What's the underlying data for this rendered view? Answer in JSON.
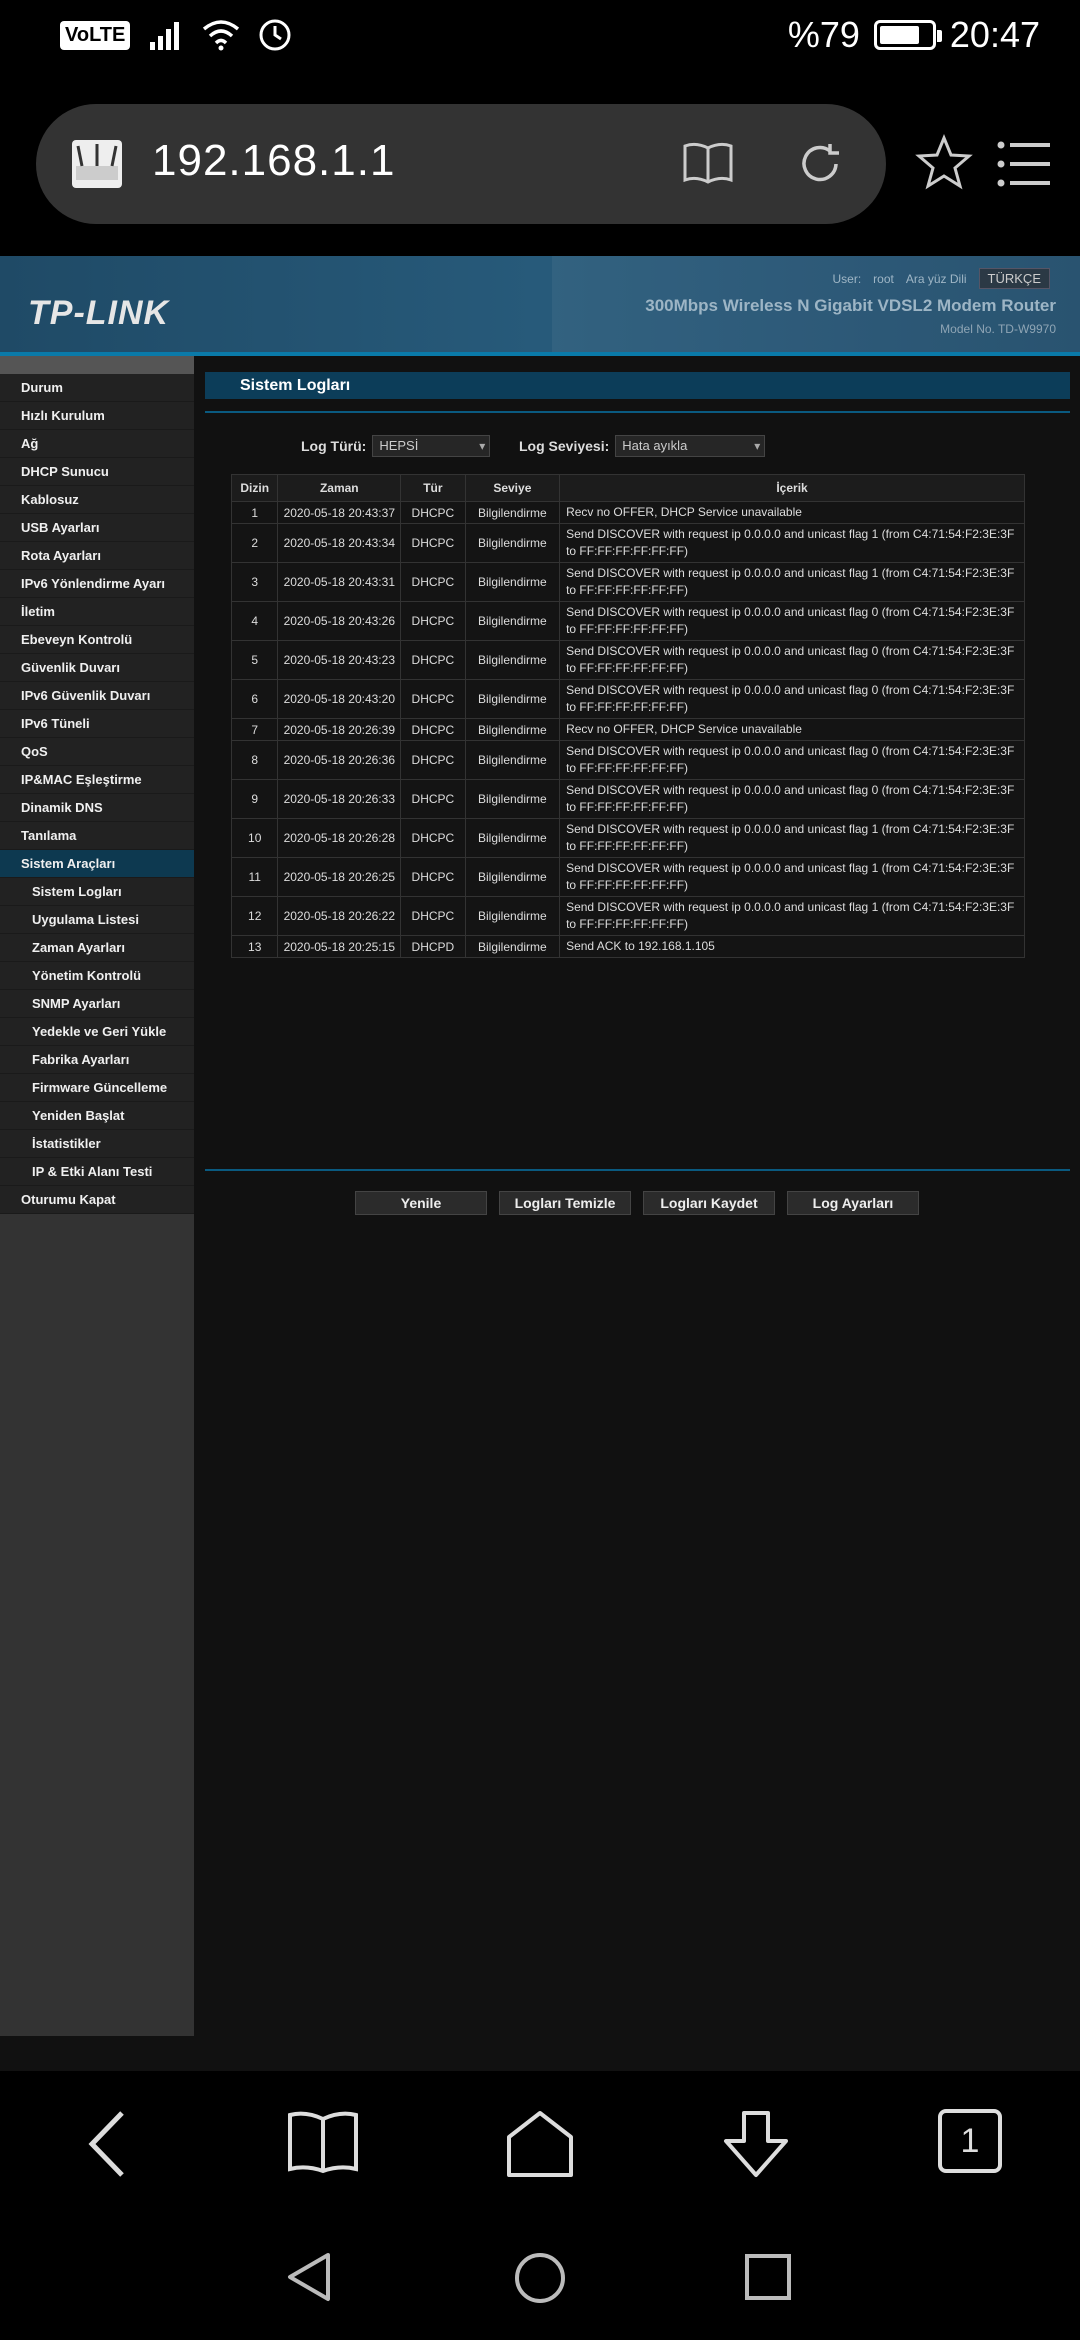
{
  "status_bar": {
    "battery": "%79",
    "time": "20:47",
    "network": "VoLTE"
  },
  "browser": {
    "url": "192.168.1.1",
    "tab_count": "1"
  },
  "router": {
    "brand": "TP-LINK",
    "user_label": "User:",
    "user": "root",
    "lang_label": "Ara yüz Dili",
    "lang": "TÜRKÇE",
    "model_title": "300Mbps Wireless N Gigabit VDSL2 Modem Router",
    "model_no": "Model No. TD-W9970"
  },
  "sidebar": [
    {
      "label": "Durum",
      "sub": false
    },
    {
      "label": "Hızlı Kurulum",
      "sub": false
    },
    {
      "label": "Ağ",
      "sub": false
    },
    {
      "label": "DHCP Sunucu",
      "sub": false
    },
    {
      "label": "Kablosuz",
      "sub": false
    },
    {
      "label": "USB Ayarları",
      "sub": false
    },
    {
      "label": "Rota Ayarları",
      "sub": false
    },
    {
      "label": "IPv6 Yönlendirme Ayarı",
      "sub": false
    },
    {
      "label": "İletim",
      "sub": false
    },
    {
      "label": "Ebeveyn Kontrolü",
      "sub": false
    },
    {
      "label": "Güvenlik Duvarı",
      "sub": false
    },
    {
      "label": "IPv6 Güvenlik Duvarı",
      "sub": false
    },
    {
      "label": "IPv6 Tüneli",
      "sub": false
    },
    {
      "label": "QoS",
      "sub": false
    },
    {
      "label": "IP&MAC Eşleştirme",
      "sub": false
    },
    {
      "label": "Dinamik DNS",
      "sub": false
    },
    {
      "label": "Tanılama",
      "sub": false
    },
    {
      "label": "Sistem Araçları",
      "sub": false,
      "active": true
    },
    {
      "label": "Sistem Logları",
      "sub": true
    },
    {
      "label": "Uygulama Listesi",
      "sub": true
    },
    {
      "label": "Zaman Ayarları",
      "sub": true
    },
    {
      "label": "Yönetim Kontrolü",
      "sub": true
    },
    {
      "label": "SNMP Ayarları",
      "sub": true
    },
    {
      "label": "Yedekle ve Geri Yükle",
      "sub": true
    },
    {
      "label": "Fabrika Ayarları",
      "sub": true
    },
    {
      "label": "Firmware Güncelleme",
      "sub": true
    },
    {
      "label": "Yeniden Başlat",
      "sub": true
    },
    {
      "label": "İstatistikler",
      "sub": true
    },
    {
      "label": "IP & Etki Alanı Testi",
      "sub": true
    },
    {
      "label": "Oturumu Kapat",
      "sub": false
    }
  ],
  "page": {
    "title": "Sistem Logları",
    "log_type_label": "Log Türü:",
    "log_type": "HEPSİ",
    "log_level_label": "Log Seviyesi:",
    "log_level": "Hata ayıkla",
    "columns": [
      "Dizin",
      "Zaman",
      "Tür",
      "Seviye",
      "İçerik"
    ],
    "rows": [
      [
        "1",
        "2020-05-18 20:43:37",
        "DHCPC",
        "Bilgilendirme",
        "Recv no OFFER, DHCP Service unavailable"
      ],
      [
        "2",
        "2020-05-18 20:43:34",
        "DHCPC",
        "Bilgilendirme",
        "Send DISCOVER with request ip 0.0.0.0 and unicast flag 1 (from C4:71:54:F2:3E:3F to FF:FF:FF:FF:FF:FF)"
      ],
      [
        "3",
        "2020-05-18 20:43:31",
        "DHCPC",
        "Bilgilendirme",
        "Send DISCOVER with request ip 0.0.0.0 and unicast flag 1 (from C4:71:54:F2:3E:3F to FF:FF:FF:FF:FF:FF)"
      ],
      [
        "4",
        "2020-05-18 20:43:26",
        "DHCPC",
        "Bilgilendirme",
        "Send DISCOVER with request ip 0.0.0.0 and unicast flag 0 (from C4:71:54:F2:3E:3F to FF:FF:FF:FF:FF:FF)"
      ],
      [
        "5",
        "2020-05-18 20:43:23",
        "DHCPC",
        "Bilgilendirme",
        "Send DISCOVER with request ip 0.0.0.0 and unicast flag 0 (from C4:71:54:F2:3E:3F to FF:FF:FF:FF:FF:FF)"
      ],
      [
        "6",
        "2020-05-18 20:43:20",
        "DHCPC",
        "Bilgilendirme",
        "Send DISCOVER with request ip 0.0.0.0 and unicast flag 0 (from C4:71:54:F2:3E:3F to FF:FF:FF:FF:FF:FF)"
      ],
      [
        "7",
        "2020-05-18 20:26:39",
        "DHCPC",
        "Bilgilendirme",
        "Recv no OFFER, DHCP Service unavailable"
      ],
      [
        "8",
        "2020-05-18 20:26:36",
        "DHCPC",
        "Bilgilendirme",
        "Send DISCOVER with request ip 0.0.0.0 and unicast flag 0 (from C4:71:54:F2:3E:3F to FF:FF:FF:FF:FF:FF)"
      ],
      [
        "9",
        "2020-05-18 20:26:33",
        "DHCPC",
        "Bilgilendirme",
        "Send DISCOVER with request ip 0.0.0.0 and unicast flag 0 (from C4:71:54:F2:3E:3F to FF:FF:FF:FF:FF:FF)"
      ],
      [
        "10",
        "2020-05-18 20:26:28",
        "DHCPC",
        "Bilgilendirme",
        "Send DISCOVER with request ip 0.0.0.0 and unicast flag 1 (from C4:71:54:F2:3E:3F to FF:FF:FF:FF:FF:FF)"
      ],
      [
        "11",
        "2020-05-18 20:26:25",
        "DHCPC",
        "Bilgilendirme",
        "Send DISCOVER with request ip 0.0.0.0 and unicast flag 1 (from C4:71:54:F2:3E:3F to FF:FF:FF:FF:FF:FF)"
      ],
      [
        "12",
        "2020-05-18 20:26:22",
        "DHCPC",
        "Bilgilendirme",
        "Send DISCOVER with request ip 0.0.0.0 and unicast flag 1 (from C4:71:54:F2:3E:3F to FF:FF:FF:FF:FF:FF)"
      ],
      [
        "13",
        "2020-05-18 20:25:15",
        "DHCPD",
        "Bilgilendirme",
        "Send ACK to 192.168.1.105"
      ]
    ],
    "buttons": [
      "Yenile",
      "Logları Temizle",
      "Logları Kaydet",
      "Log Ayarları"
    ]
  }
}
